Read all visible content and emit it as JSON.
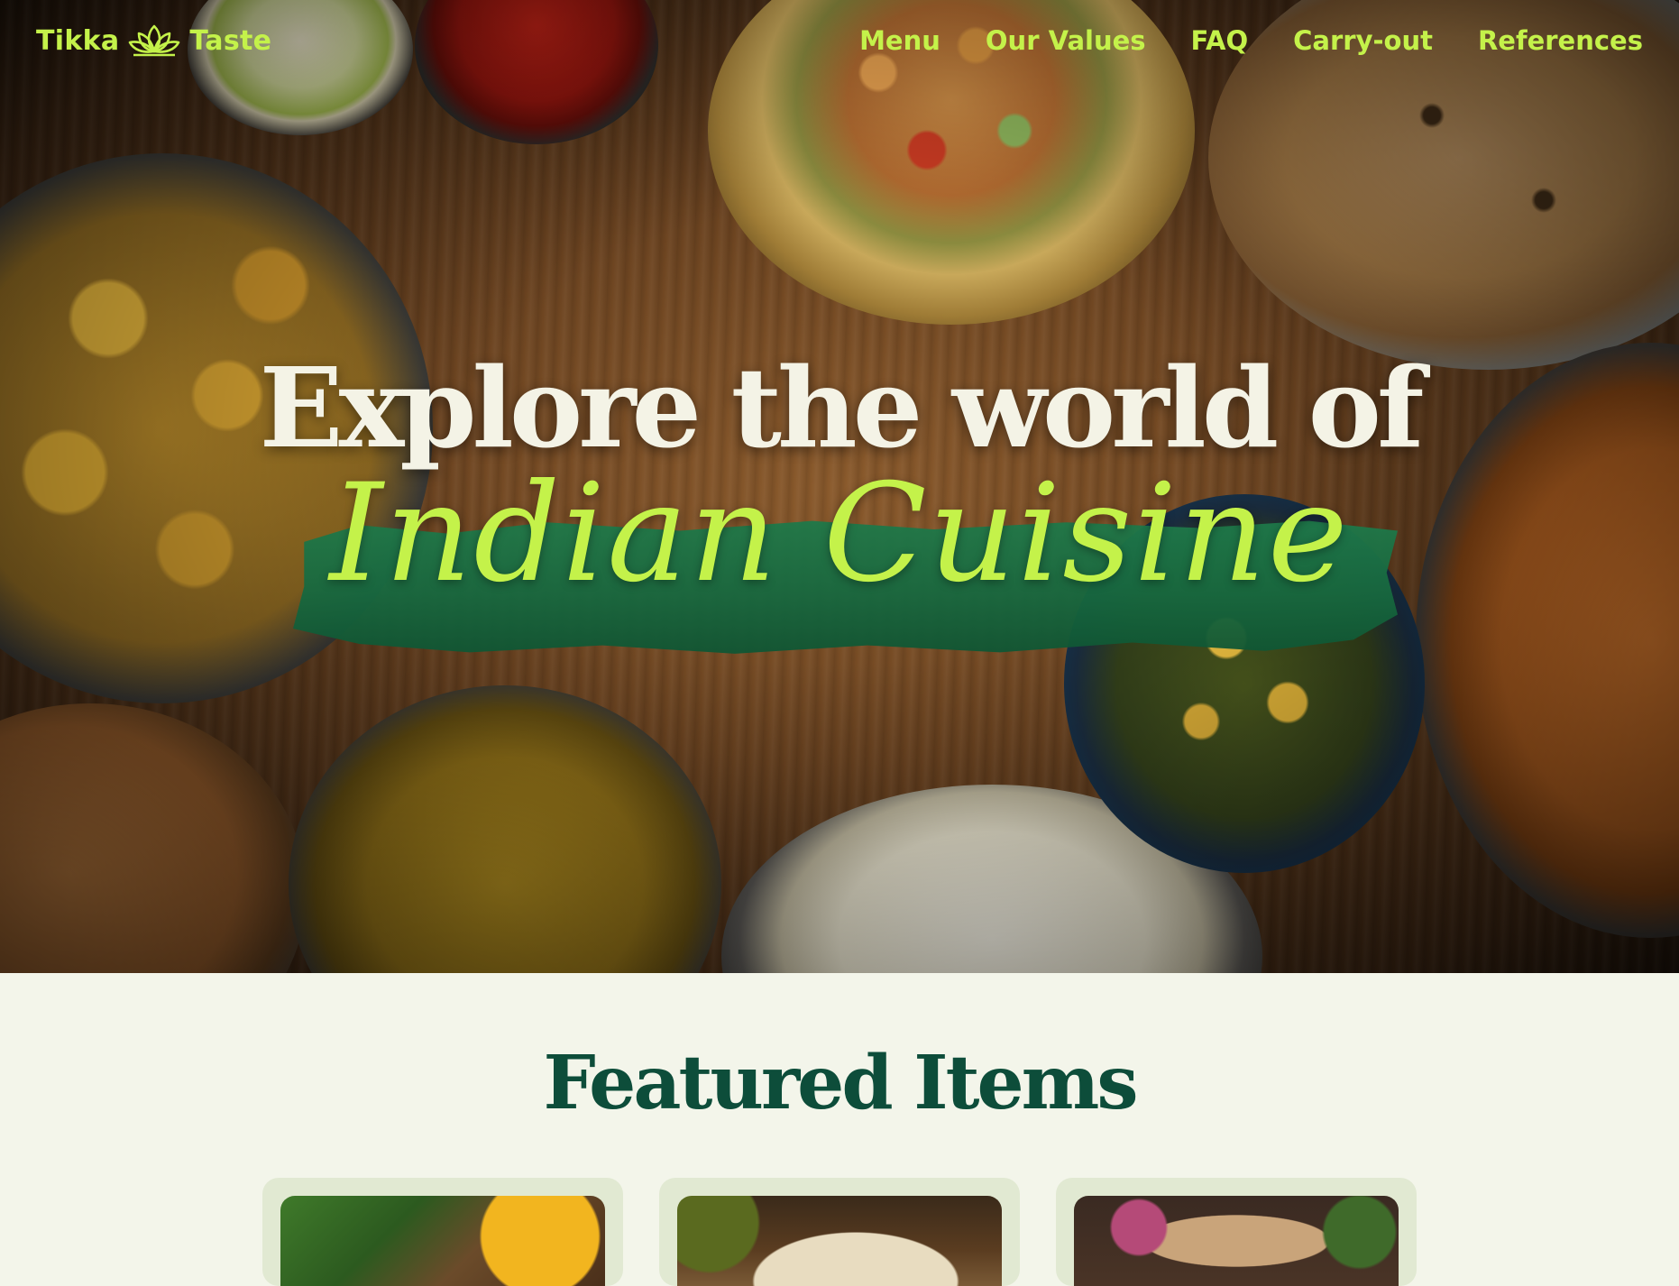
{
  "brand": {
    "name_left": "Tikka",
    "name_right": "Taste",
    "icon": "lotus-icon",
    "accent_color": "#c4f24a",
    "dark_green": "#0d4d3a"
  },
  "nav": {
    "links": [
      {
        "label": "Menu"
      },
      {
        "label": "Our Values"
      },
      {
        "label": "FAQ"
      },
      {
        "label": "Carry-out"
      },
      {
        "label": "References"
      }
    ]
  },
  "hero": {
    "title_line1": "Explore the world of",
    "title_line2": "Indian Cuisine"
  },
  "featured": {
    "title": "Featured Items"
  }
}
